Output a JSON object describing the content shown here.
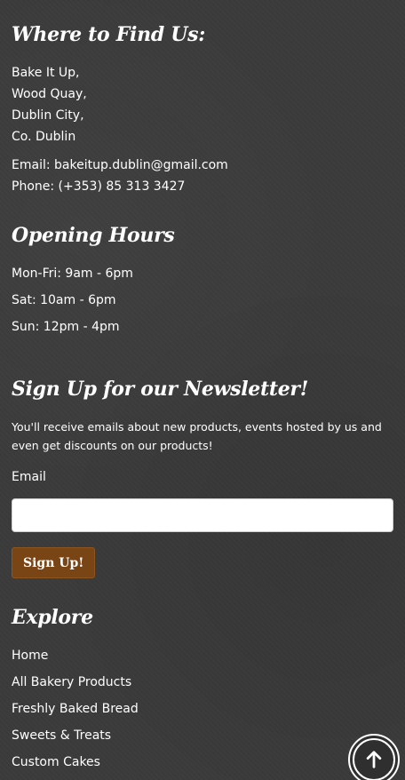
{
  "find_us": {
    "title": "Where to Find Us:",
    "address_lines": [
      "Bake It Up,",
      "Wood Quay,",
      "Dublin City,",
      "Co. Dublin"
    ],
    "email": "Email: bakeitup.dublin@gmail.com",
    "phone": "Phone: (+353) 85 313 3427"
  },
  "opening_hours": {
    "title": "Opening Hours",
    "rows": [
      "Mon-Fri: 9am - 6pm",
      "Sat: 10am - 6pm",
      "Sun: 12pm - 4pm"
    ]
  },
  "newsletter": {
    "title": "Sign Up for our Newsletter!",
    "description": "You'll receive emails about new products, events hosted by us and even get discounts on our products!",
    "email_label": "Email",
    "email_value": "",
    "button_label": "Sign Up!"
  },
  "explore": {
    "title": "Explore",
    "links": [
      "Home",
      "All Bakery Products",
      "Freshly Baked Bread",
      "Sweets & Treats",
      "Custom Cakes"
    ]
  },
  "back_to_top": {
    "icon": "arrow-up-icon"
  }
}
